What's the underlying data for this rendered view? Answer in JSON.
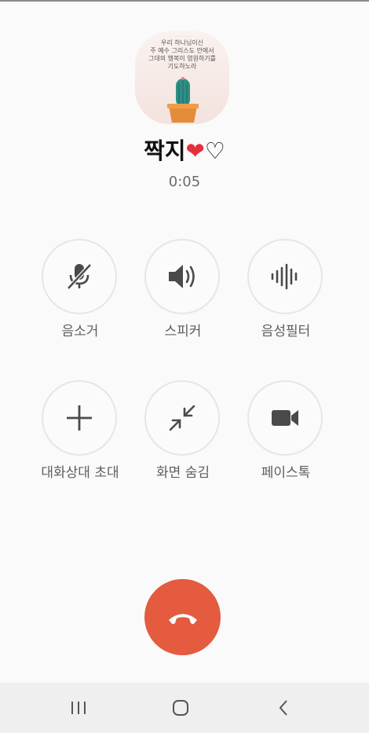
{
  "caller": {
    "name": "짝지",
    "name_hearts_red": "❤",
    "name_hearts_outline": "♡",
    "duration": "0:05"
  },
  "avatar": {
    "lines": [
      "우리 하나님이신",
      "주 예수 그리스도 안에서",
      "그대의 행복이 영원하기를",
      "기도하노라"
    ]
  },
  "controls": {
    "mute_label": "음소거",
    "speaker_label": "스피커",
    "voice_filter_label": "음성필터",
    "add_call_label": "대화상대 초대",
    "hide_screen_label": "화면 숨김",
    "facetalk_label": "페이스톡"
  },
  "colors": {
    "end_call": "#e45b3f",
    "icon": "#4a4a4a",
    "heart": "#e3303b"
  },
  "icons": {
    "mute": "microphone-off-icon",
    "speaker": "speaker-icon",
    "voice_filter": "voice-wave-icon",
    "add_call": "plus-icon",
    "hide_screen": "minimize-icon",
    "facetalk": "video-camera-icon",
    "end_call": "phone-hangup-icon"
  }
}
